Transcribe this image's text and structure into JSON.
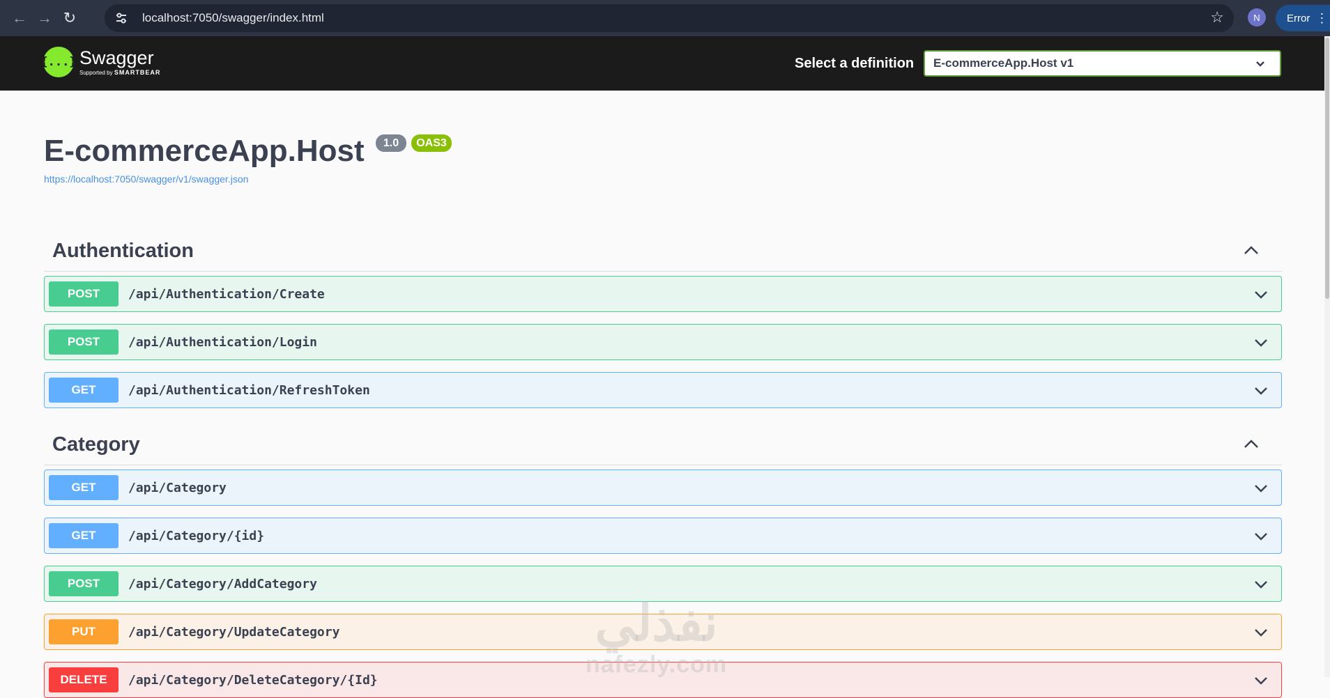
{
  "browser": {
    "url": "localhost:7050/swagger/index.html",
    "profile_initial": "N",
    "error_label": "Error"
  },
  "topbar": {
    "logo_title": "Swagger",
    "logo_sub_prefix": "Supported by",
    "logo_sub_brand": "SMARTBEAR",
    "definition_label": "Select a definition",
    "definition_value": "E-commerceApp.Host v1"
  },
  "info": {
    "title": "E-commerceApp.Host",
    "version": "1.0",
    "oas_badge": "OAS3",
    "spec_url": "https://localhost:7050/swagger/v1/swagger.json"
  },
  "tags": [
    {
      "name": "Authentication",
      "operations": [
        {
          "method": "POST",
          "path": "/api/Authentication/Create"
        },
        {
          "method": "POST",
          "path": "/api/Authentication/Login"
        },
        {
          "method": "GET",
          "path": "/api/Authentication/RefreshToken"
        }
      ]
    },
    {
      "name": "Category",
      "operations": [
        {
          "method": "GET",
          "path": "/api/Category"
        },
        {
          "method": "GET",
          "path": "/api/Category/{id}"
        },
        {
          "method": "POST",
          "path": "/api/Category/AddCategory"
        },
        {
          "method": "PUT",
          "path": "/api/Category/UpdateCategory"
        },
        {
          "method": "DELETE",
          "path": "/api/Category/DeleteCategory/{Id}"
        }
      ]
    }
  ],
  "watermark": {
    "arabic": "نفذلي",
    "latin": "nafezly.com"
  },
  "colors": {
    "get": "#61affe",
    "post": "#49cc90",
    "put": "#fca130",
    "delete": "#f93e3e",
    "swagger_green": "#85ea2d",
    "topbar_bg": "#1b1b1b"
  },
  "icons": {
    "back": "arrow-left-icon",
    "forward": "arrow-right-icon",
    "reload": "reload-icon",
    "site_settings": "tune-icon",
    "bookmark": "star-icon",
    "menu": "kebab-menu-icon",
    "collapse": "chevron-up-icon",
    "expand": "chevron-down-icon"
  }
}
